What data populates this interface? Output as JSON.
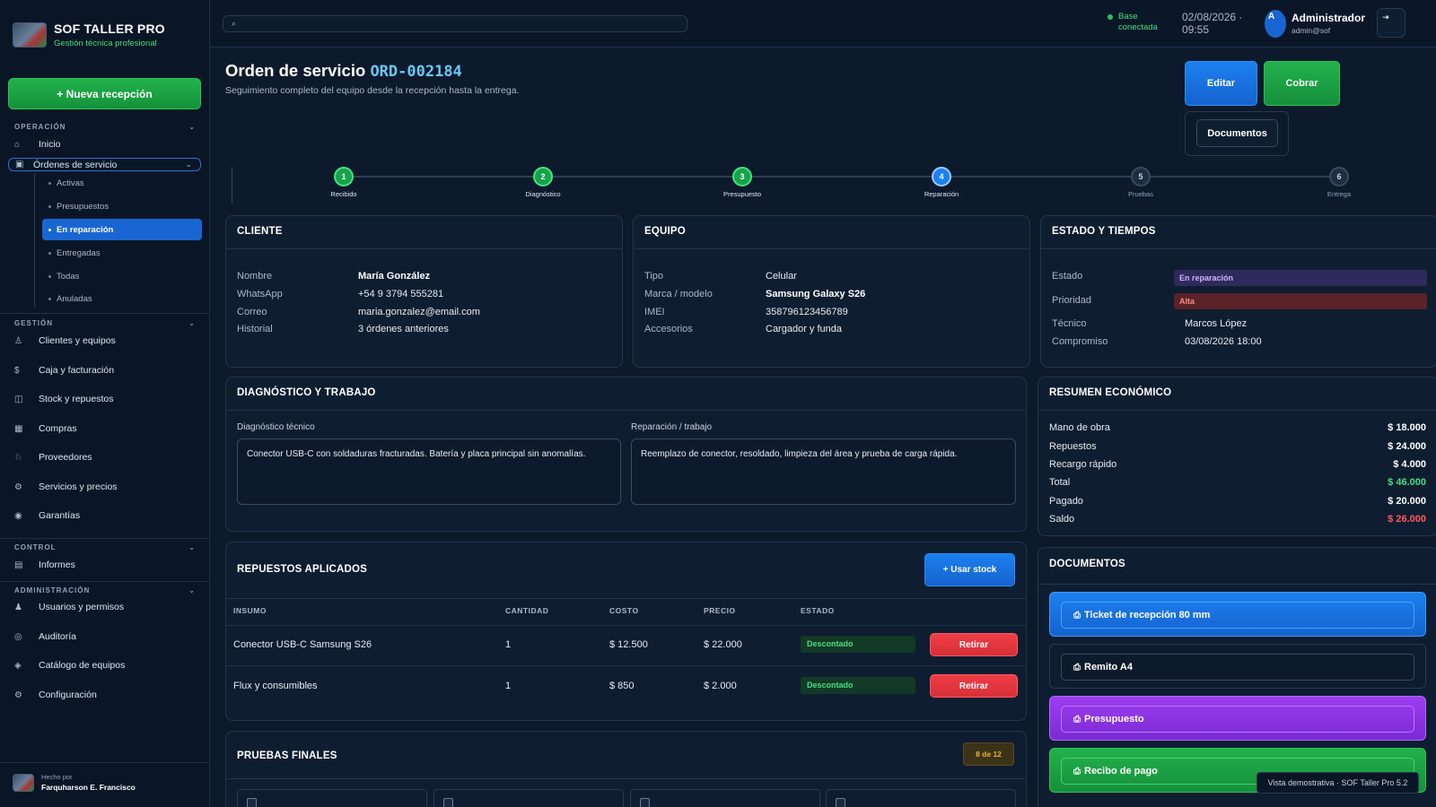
{
  "brand": {
    "title": "SOF TALLER PRO",
    "subtitle": "Gestión técnica profesional"
  },
  "sidebar": {
    "new_reception": "+ Nueva recepción",
    "sections": {
      "operacion": "OPERACIÓN",
      "gestion": "GESTIÓN",
      "control": "CONTROL",
      "administracion": "ADMINISTRACIÓN"
    },
    "operacion_items": [
      {
        "label": "Inicio",
        "icon": "home-icon"
      },
      {
        "label": "Órdenes de servicio",
        "icon": "clipboard-icon"
      }
    ],
    "ordenes_sub": [
      "Activas",
      "Presupuestos",
      "En reparación",
      "Entregadas",
      "Todas",
      "Anuladas"
    ],
    "gestion_items": [
      {
        "label": "Clientes y equipos",
        "icon": "users-icon"
      },
      {
        "label": "Caja y facturación",
        "icon": "dollar-icon"
      },
      {
        "label": "Stock y repuestos",
        "icon": "box-icon"
      },
      {
        "label": "Compras",
        "icon": "cart-icon"
      },
      {
        "label": "Proveedores",
        "icon": "truck-icon"
      },
      {
        "label": "Servicios y precios",
        "icon": "gear-icon"
      },
      {
        "label": "Garantías",
        "icon": "shield-icon"
      }
    ],
    "control_items": [
      {
        "label": "Informes",
        "icon": "report-icon"
      }
    ],
    "admin_items": [
      {
        "label": "Usuarios y permisos",
        "icon": "user-icon"
      },
      {
        "label": "Auditoría",
        "icon": "eye-icon"
      },
      {
        "label": "Catálogo de equipos",
        "icon": "diamond-icon"
      },
      {
        "label": "Configuración",
        "icon": "settings-icon"
      }
    ],
    "footer": {
      "made_by": "Hecho por",
      "author": "Farquharson E. Francisco"
    }
  },
  "topbar": {
    "search_placeholder": "⌕",
    "status_line1": "Base",
    "status_line2": "conectada",
    "date": "02/08/2026 ·",
    "time": "09:55",
    "avatar_initial": "A",
    "user_name": "Administrador",
    "user_email": "admin@sof",
    "logout_icon": "⇥"
  },
  "header": {
    "title": "Orden de servicio",
    "order_code": "ORD-002184",
    "subtitle": "Seguimiento completo del equipo desde la recepción hasta la entrega.",
    "edit": "Editar",
    "pay": "Cobrar",
    "documents": "Documentos"
  },
  "stepper": [
    {
      "num": "1",
      "label": "Recibido",
      "state": "done"
    },
    {
      "num": "2",
      "label": "Diagnóstico",
      "state": "done"
    },
    {
      "num": "3",
      "label": "Presupuesto",
      "state": "done"
    },
    {
      "num": "4",
      "label": "Reparación",
      "state": "current"
    },
    {
      "num": "5",
      "label": "Pruebas",
      "state": "pending"
    },
    {
      "num": "6",
      "label": "Entrega",
      "state": "pending"
    }
  ],
  "client": {
    "title": "CLIENTE",
    "rows": [
      {
        "k": "Nombre",
        "v": "María González"
      },
      {
        "k": "WhatsApp",
        "v": "+54 9 3794 555281"
      },
      {
        "k": "Correo",
        "v": "maria.gonzalez@email.com"
      },
      {
        "k": "Historial",
        "v": "3 órdenes anteriores"
      }
    ]
  },
  "device": {
    "title": "EQUIPO",
    "rows": [
      {
        "k": "Tipo",
        "v": "Celular"
      },
      {
        "k": "Marca / modelo",
        "v": "Samsung Galaxy S26"
      },
      {
        "k": "IMEI",
        "v": "358796123456789"
      },
      {
        "k": "Accesorios",
        "v": "Cargador y funda"
      }
    ]
  },
  "status_card": {
    "title": "ESTADO Y TIEMPOS",
    "estado_k": "Estado",
    "estado_v": "En reparación",
    "prioridad_k": "Prioridad",
    "prioridad_v": "Alta",
    "tecnico_k": "Técnico",
    "tecnico_v": "Marcos López",
    "compromiso_k": "Compromiso",
    "compromiso_v": "03/08/2026 18:00"
  },
  "diagnostic": {
    "title": "DIAGNÓSTICO Y TRABAJO",
    "diag_label": "Diagnóstico técnico",
    "diag_text": "Conector USB-C con soldaduras fracturadas. Batería y placa principal sin anomalías.",
    "work_label": "Reparación / trabajo",
    "work_text": "Reemplazo de conector, resoldado, limpieza del área y prueba de carga rápida."
  },
  "summary": {
    "title": "RESUMEN ECONÓMICO",
    "rows": [
      {
        "k": "Mano de obra",
        "v": "$ 18.000"
      },
      {
        "k": "Repuestos",
        "v": "$ 24.000"
      },
      {
        "k": "Recargo rápido",
        "v": "$ 4.000"
      },
      {
        "k": "Total",
        "v": "$ 46.000"
      },
      {
        "k": "Pagado",
        "v": "$ 20.000"
      },
      {
        "k": "Saldo",
        "v": "$ 26.000"
      }
    ]
  },
  "parts": {
    "title": "REPUESTOS APLICADOS",
    "use_stock": "+ Usar stock",
    "headers": [
      "INSUMO",
      "CANTIDAD",
      "COSTO",
      "PRECIO",
      "ESTADO"
    ],
    "rows": [
      {
        "item": "Conector USB-C Samsung S26",
        "qty": "1",
        "cost": "$ 12.500",
        "price": "$ 22.000",
        "status": "Descontado",
        "action": "Retirar"
      },
      {
        "item": "Flux y consumibles",
        "qty": "1",
        "cost": "$ 850",
        "price": "$ 2.000",
        "status": "Descontado",
        "action": "Retirar"
      }
    ]
  },
  "tests": {
    "title": "PRUEBAS FINALES",
    "count": "8 de 12"
  },
  "documents": {
    "title": "DOCUMENTOS",
    "items": [
      "Ticket de recepción 80 mm",
      "Remito A4",
      "Presupuesto",
      "Recibo de pago"
    ]
  },
  "toast": "Vista demostrativa · SOF Taller Pro 5.2"
}
